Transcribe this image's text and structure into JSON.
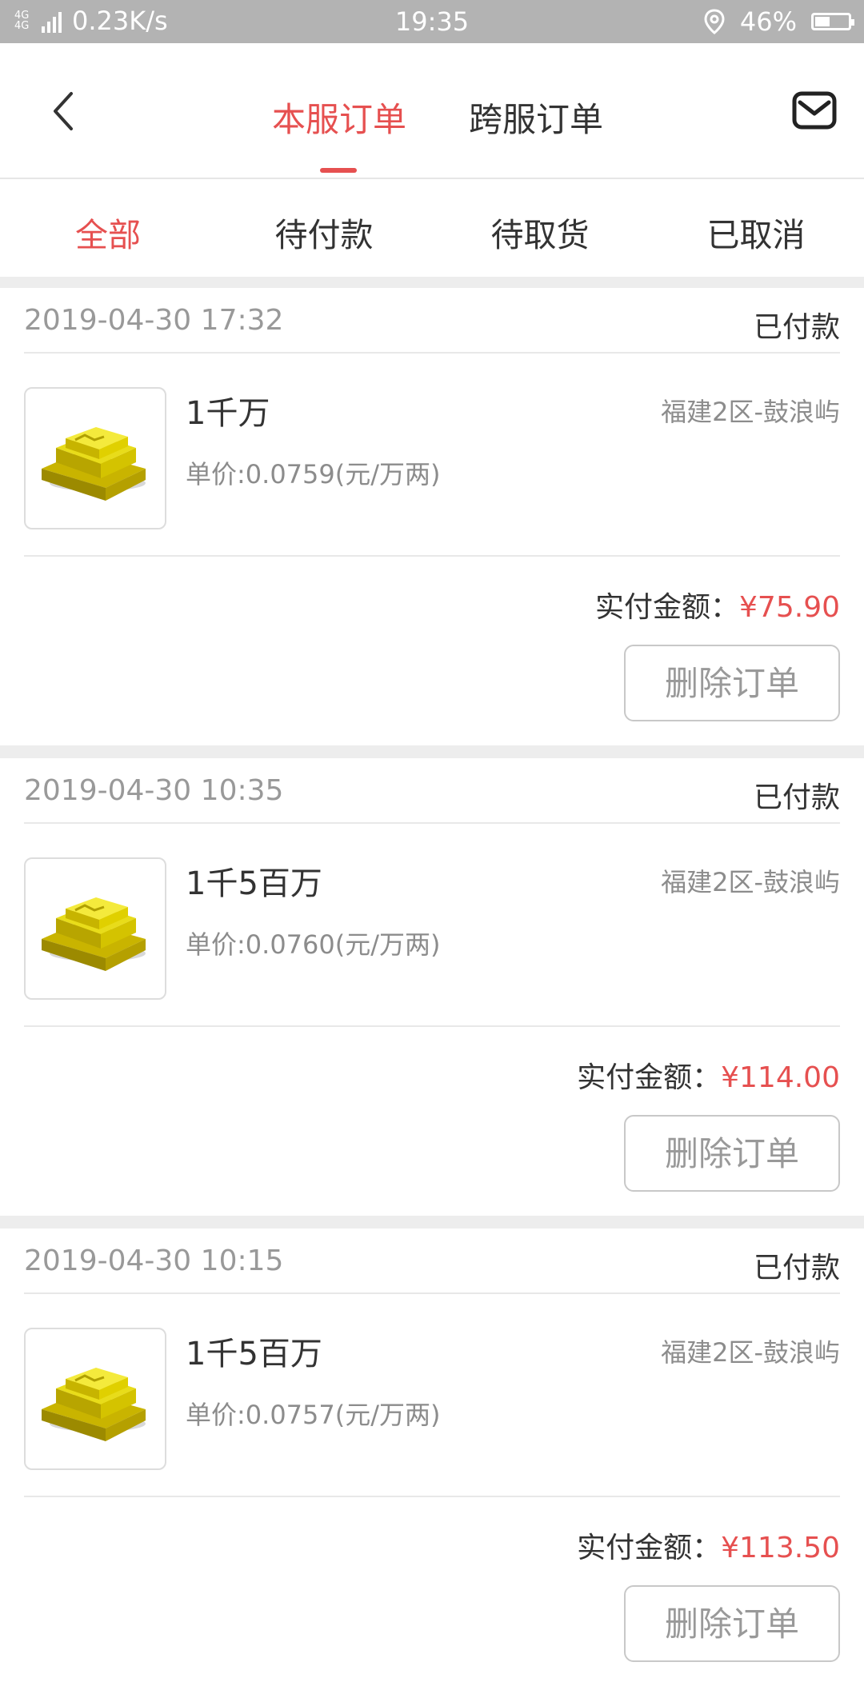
{
  "status_bar": {
    "network": "4G 4G",
    "speed": "0.23K/s",
    "time": "19:35",
    "battery": "46%",
    "battery_level": 0.46
  },
  "header": {
    "tabs": [
      {
        "label": "本服订单",
        "active": true
      },
      {
        "label": "跨服订单",
        "active": false
      }
    ],
    "icons": {
      "back": "back-arrow-icon",
      "mail": "mail-icon"
    }
  },
  "filters": [
    {
      "label": "全部",
      "active": true
    },
    {
      "label": "待付款",
      "active": false
    },
    {
      "label": "待取货",
      "active": false
    },
    {
      "label": "已取消",
      "active": false
    }
  ],
  "orders": [
    {
      "date": "2019-04-30 17:32",
      "status": "已付款",
      "name": "1千万",
      "server": "福建2区-鼓浪屿",
      "unit_price": "单价:0.0759(元/万两)",
      "total_label": "实付金额：",
      "total_amount": "¥75.90",
      "delete_label": "删除订单"
    },
    {
      "date": "2019-04-30 10:35",
      "status": "已付款",
      "name": "1千5百万",
      "server": "福建2区-鼓浪屿",
      "unit_price": "单价:0.0760(元/万两)",
      "total_label": "实付金额：",
      "total_amount": "¥114.00",
      "delete_label": "删除订单"
    },
    {
      "date": "2019-04-30 10:15",
      "status": "已付款",
      "name": "1千5百万",
      "server": "福建2区-鼓浪屿",
      "unit_price": "单价:0.0757(元/万两)",
      "total_label": "实付金额：",
      "total_amount": "¥113.50",
      "delete_label": "删除订单"
    }
  ],
  "colors": {
    "accent": "#e65050",
    "text": "#333333",
    "muted": "#999999",
    "statusbar": "#b3b3b3"
  }
}
